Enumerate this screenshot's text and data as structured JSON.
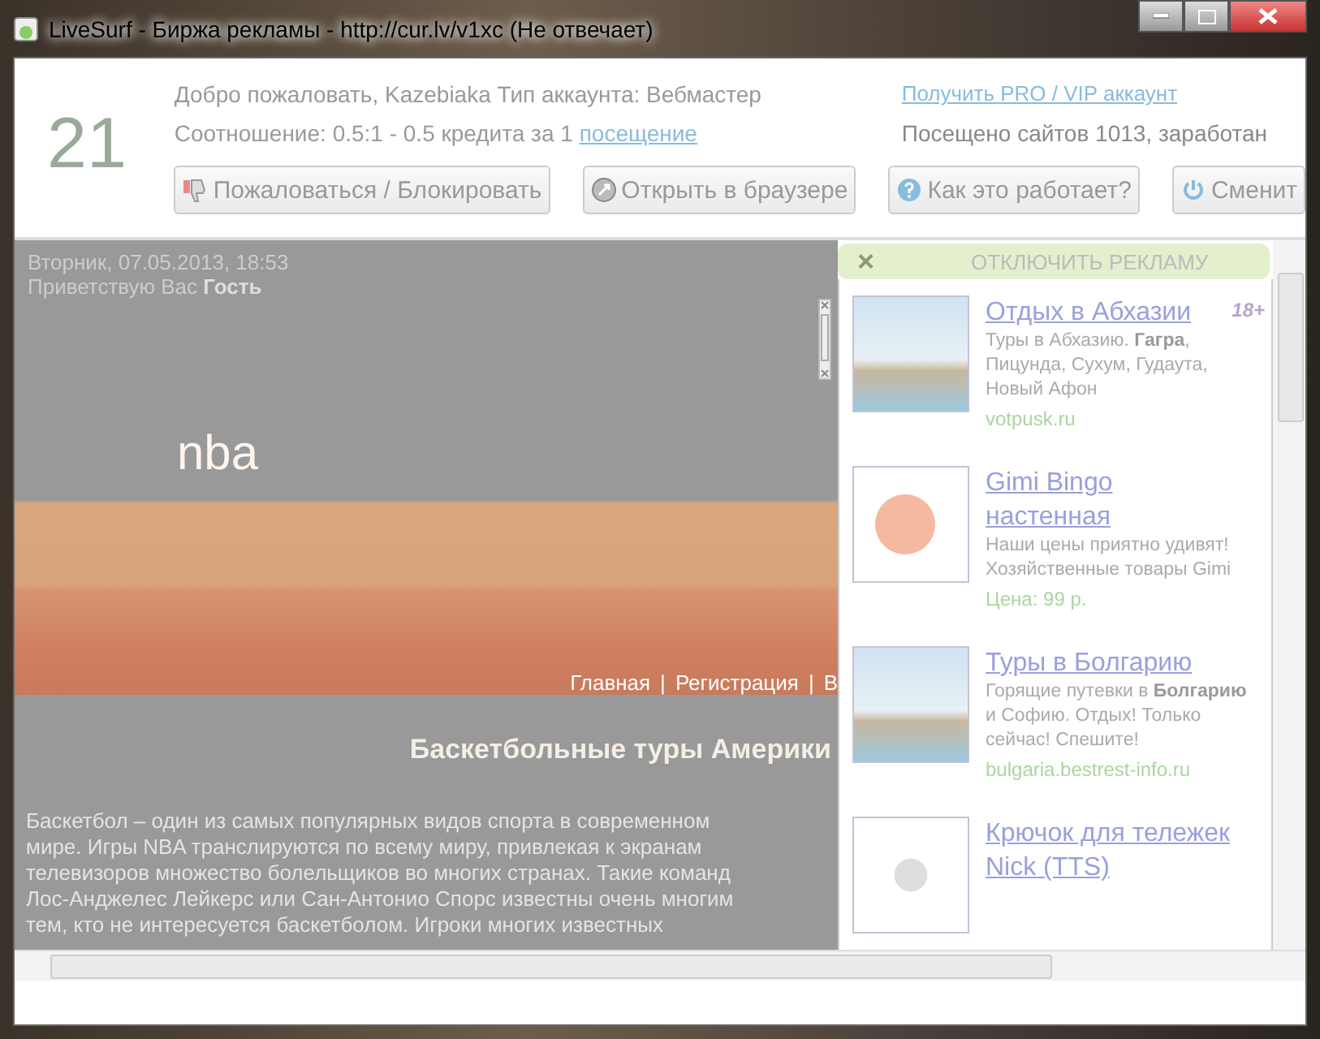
{
  "window": {
    "title": "LiveSurf - Биржа рекламы - http://cur.lv/v1xc (Не отвечает)"
  },
  "header": {
    "counter": "21",
    "welcome": "Добро пожаловать, Kazebiaka  Тип аккаунта: Вебмастер",
    "ratio": "Соотношение: 0.5:1 - 0.5 кредита за 1",
    "ratio_link": "посещение",
    "pro_link": "Получить PRO / VIP аккаунт",
    "stats": "Посещено сайтов 1013, заработан",
    "buttons": [
      {
        "kind": "report",
        "label": "Пожаловаться / Блокировать"
      },
      {
        "kind": "browser",
        "label": "Открыть в браузере"
      },
      {
        "kind": "help",
        "label": "Как это работает?"
      },
      {
        "kind": "switch",
        "label": "Сменит"
      }
    ]
  },
  "page": {
    "date": "Вторник, 07.05.2013, 18:53",
    "greeting": "Приветствую Вас **Гость**",
    "logo": "nba",
    "nav": [
      "Главная",
      "Регистрация",
      "В"
    ],
    "nav_separator": "|",
    "heading": "Баскетбольные туры Америки",
    "paragraph_lines": [
      "Баскетбол – один из самых популярных видов спорта в современном",
      "мире. Игры NBA транслируются по всему миру, привлекая к экранам",
      "телевизоров множество болельщиков во многих странах. Такие команд",
      "Лос-Анджелес Лейкерс или Сан-Антонио Спорс известны очень многим",
      "тем, кто не интересуется баскетболом. Игроки многих известных"
    ]
  },
  "ads": {
    "close": "×",
    "disable": "ОТКЛЮЧИТЬ РЕКЛАМУ",
    "age": "18+",
    "items": [
      {
        "kind": "beach",
        "title": "Отдых в Абхазии",
        "text": "Туры в Абхазию. **Гагра**, Пицунда, Сухум, Гудаута, Новый Афон",
        "source": "votpusk.ru"
      },
      {
        "kind": "product",
        "title": "Gimi Bingo настенная",
        "text": "Наши цены приятно удивят! Хозяйственные товары Gimi",
        "source": "Цена: 99 р."
      },
      {
        "kind": "beach",
        "title": "Туры в Болгарию",
        "text": "Горящие путевки в **Болгарию** и Софию. Отдых! Только сейчас! Спешите!",
        "source": "bulgaria.bestrest-info.ru"
      },
      {
        "kind": "hook",
        "title": "Крючок для тележек Nick (TTS)"
      }
    ]
  }
}
